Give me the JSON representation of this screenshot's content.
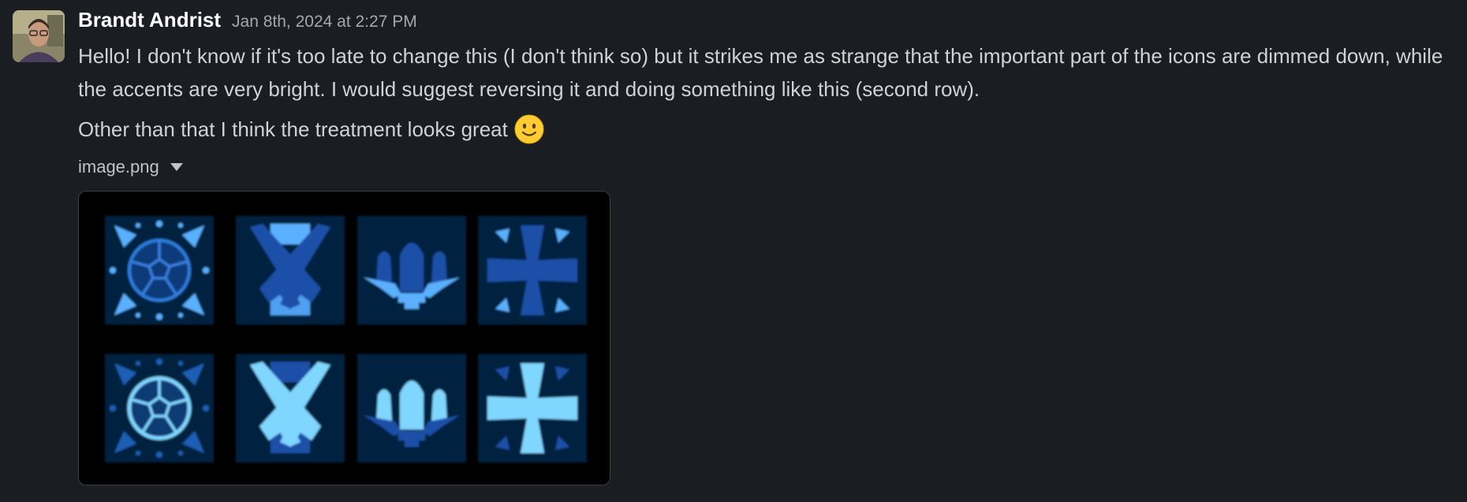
{
  "message": {
    "author": "Brandt Andrist",
    "timestamp": "Jan 8th, 2024 at 2:27 PM",
    "paragraphs": [
      "Hello! I don't know if it's too late to change this (I don't think so) but it strikes me as strange that the important part of the icons are dimmed down, while the accents are very bright. I would suggest reversing it and doing something like this (second row).",
      "Other than that I think the treatment looks great"
    ],
    "emoji": "slightly-smiling-face"
  },
  "attachment": {
    "filename": "image.png",
    "icons_top_row": [
      "soccer-ball-icon",
      "crossed-pistols-icon",
      "rocket-boosters-icon",
      "iron-cross-icon"
    ],
    "icons_bottom_row": [
      "soccer-ball-icon",
      "crossed-pistols-icon",
      "rocket-boosters-icon",
      "iron-cross-icon"
    ]
  },
  "colors": {
    "background": "#1a1d21",
    "author": "#ffffff",
    "text": "#d1d2d3",
    "timestamp": "#a6a7a9",
    "icon_dim": "#1f4f9a",
    "icon_bright": "#6fd3ff"
  }
}
